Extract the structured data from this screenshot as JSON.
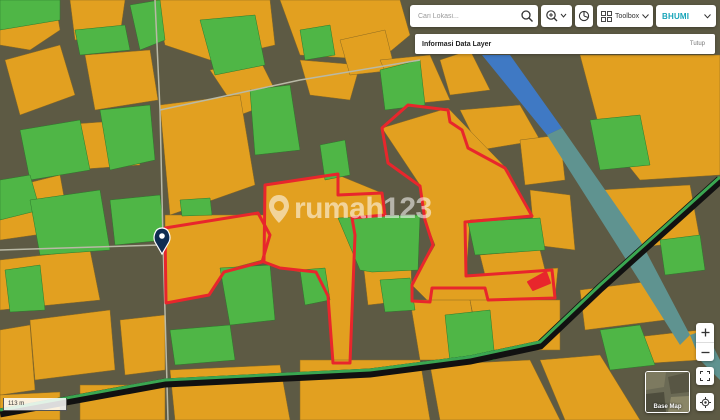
{
  "search": {
    "placeholder": "Cari Lokasi..."
  },
  "toolbar": {
    "toolbox_label": "Toolbox"
  },
  "brand": {
    "name": "BHUMI"
  },
  "info_panel": {
    "title": "Informasi Data Layer",
    "close_label": "Tutup"
  },
  "basemap": {
    "label": "Base Map"
  },
  "scale": {
    "label": "113 m"
  },
  "watermark": {
    "text": "rumah123"
  },
  "map": {
    "colors": {
      "paddy_orange": "#e2a020",
      "paddy_green": "#4fb646",
      "bare_land": "#5d5a44",
      "river": "#3f79c4",
      "canal_teal": "#5f9390",
      "boundary_red": "#e8262c",
      "road_green": "#3aa651",
      "road_black": "#111111"
    }
  }
}
